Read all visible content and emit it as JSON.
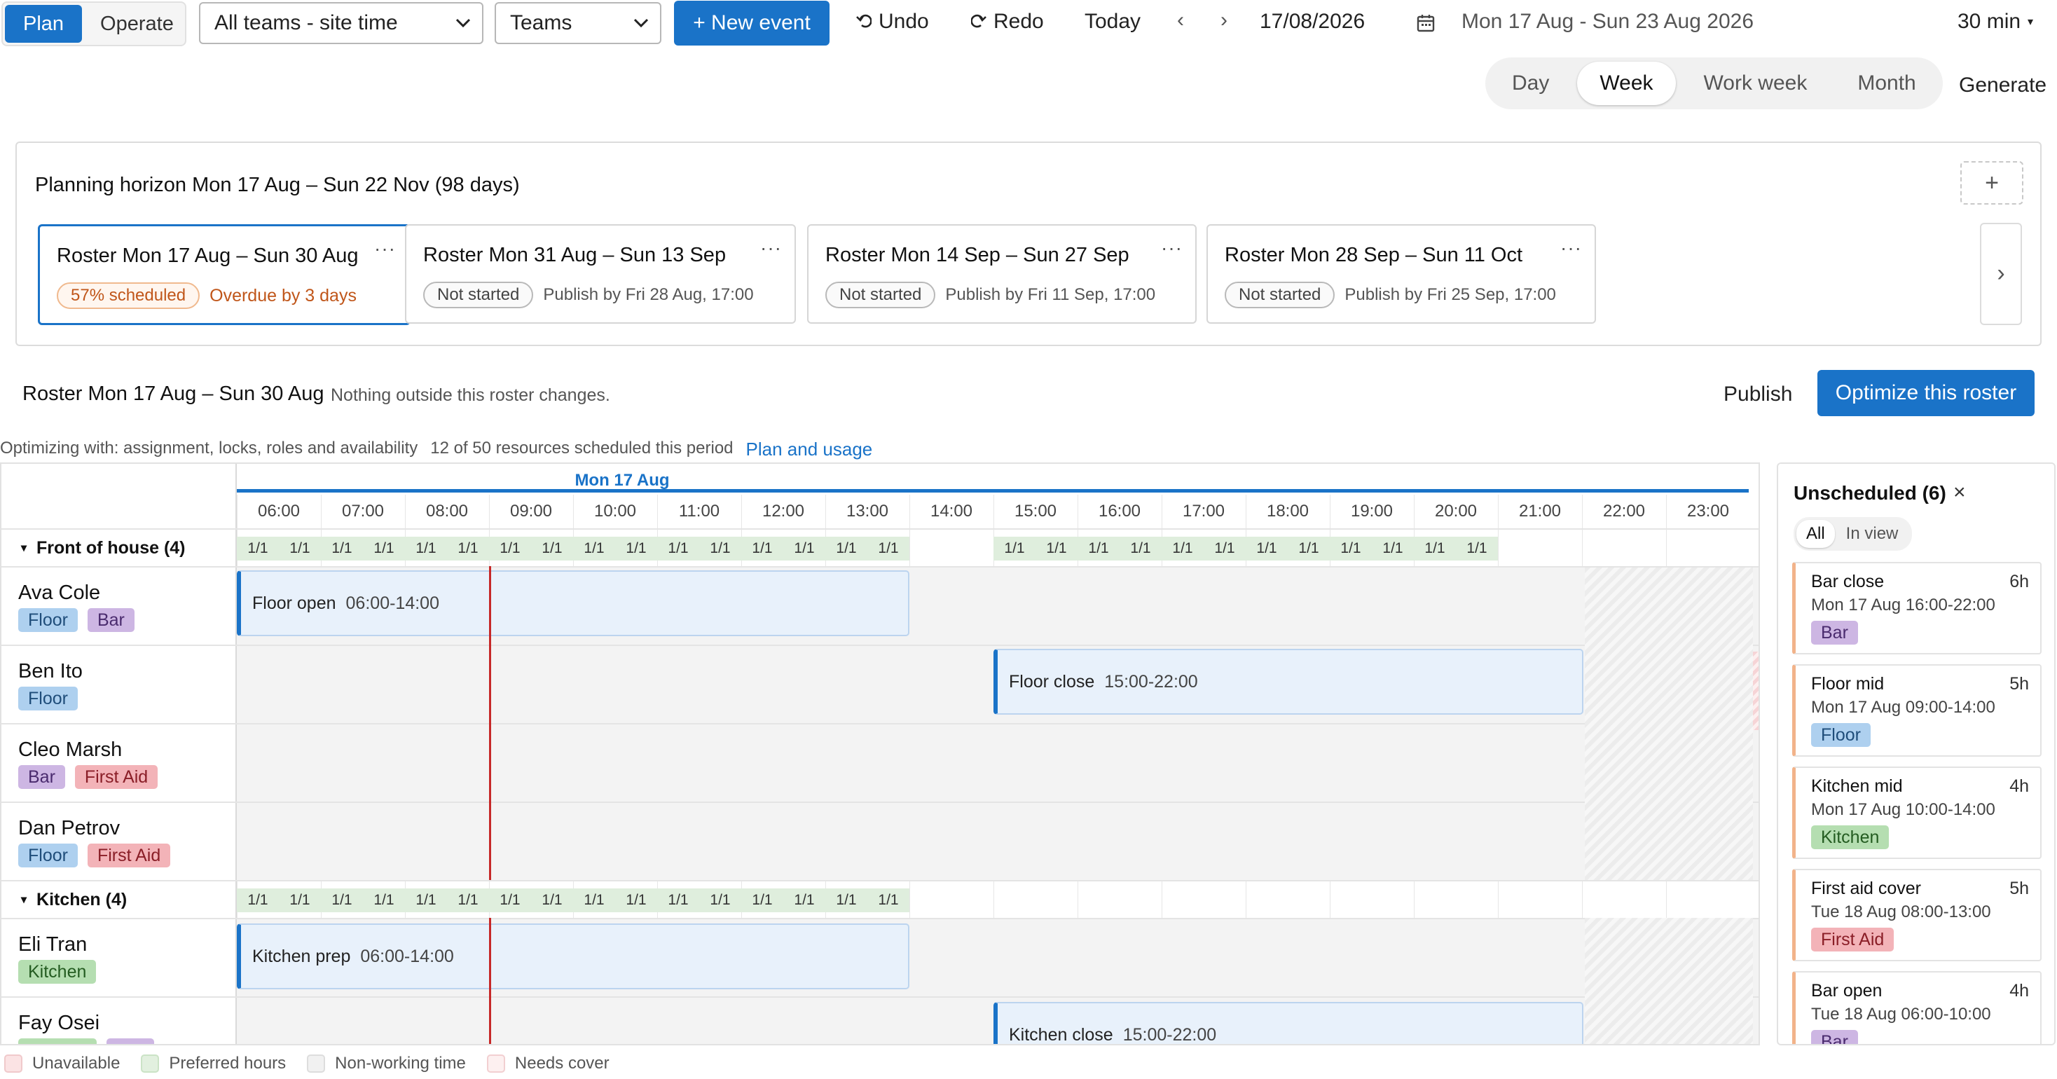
{
  "toolbar": {
    "mode_options": [
      "Plan",
      "Operate"
    ],
    "teams_filter_value": "All teams - site time",
    "group_by_value": "Teams",
    "new_event_label": "+ New event",
    "undo_label": "Undo",
    "redo_label": "Redo",
    "today_label": "Today",
    "prev_glyph": "‹",
    "next_glyph": "›",
    "date_value": "17/08/2026",
    "range_label": "Mon 17 Aug - Sun 23 Aug 2026",
    "interval_label": "30 min",
    "interval_caret": "▾",
    "views": [
      "Day",
      "Week",
      "Work week",
      "Month"
    ],
    "active_view": "Week",
    "generate_label": "Generate"
  },
  "horizon": {
    "title": "Planning horizon Mon 17 Aug – Sun 22 Nov (98 days)",
    "add_glyph": "+",
    "next_glyph": "›",
    "rosters": [
      {
        "title": "Roster Mon 17 Aug – Sun 30 Aug",
        "status": "57% scheduled",
        "note": "Overdue by 3 days",
        "active": true
      },
      {
        "title": "Roster Mon 31 Aug – Sun 13 Sep",
        "status": "Not started",
        "note": "Publish by Fri 28 Aug, 17:00",
        "active": false
      },
      {
        "title": "Roster Mon 14 Sep – Sun 27 Sep",
        "status": "Not started",
        "note": "Publish by Fri 11 Sep, 17:00",
        "active": false
      },
      {
        "title": "Roster Mon 28 Sep – Sun 11 Oct",
        "status": "Not started",
        "note": "Publish by Fri 25 Sep, 17:00",
        "active": false
      }
    ]
  },
  "roster_bar": {
    "title": "Roster Mon 17 Aug – Sun 30 Aug",
    "subtitle": "Nothing outside this roster changes.",
    "publish_label": "Publish",
    "optimize_label": "Optimize this roster"
  },
  "optimizing": {
    "text": "Optimizing with: assignment, locks, roles and availability",
    "count_text": "12 of 50 resources scheduled this period",
    "link_label": "Plan and usage"
  },
  "schedule": {
    "day_label": "Mon 17 Aug",
    "hours": [
      "06:00",
      "07:00",
      "08:00",
      "09:00",
      "10:00",
      "11:00",
      "12:00",
      "13:00",
      "14:00",
      "15:00",
      "16:00",
      "17:00",
      "18:00",
      "19:00",
      "20:00",
      "21:00",
      "22:00",
      "23:00"
    ],
    "coverage_label": "1/1",
    "groups": [
      {
        "name": "Front of house (4)",
        "caret": "▾"
      },
      {
        "name": "Kitchen (4)",
        "caret": "▾"
      }
    ],
    "people": [
      {
        "name": "Ava Cole",
        "tags": [
          "Floor",
          "Bar"
        ],
        "event": {
          "title": "Floor open",
          "time": "06:00-14:00"
        }
      },
      {
        "name": "Ben Ito",
        "tags": [
          "Floor"
        ],
        "event": {
          "title": "Floor close",
          "time": "15:00-22:00"
        }
      },
      {
        "name": "Cleo Marsh",
        "tags": [
          "Bar",
          "First Aid"
        ]
      },
      {
        "name": "Dan Petrov",
        "tags": [
          "Floor",
          "First Aid"
        ]
      },
      {
        "name": "Eli Tran",
        "tags": [
          "Kitchen"
        ],
        "event": {
          "title": "Kitchen prep",
          "time": "06:00-14:00"
        }
      },
      {
        "name": "Fay Osei",
        "tags": [],
        "event": {
          "title": "Kitchen close",
          "time": "15:00-22:00"
        }
      }
    ]
  },
  "unscheduled": {
    "title": "Unscheduled (6)",
    "close_glyph": "×",
    "filters": [
      "All",
      "In view"
    ],
    "items": [
      {
        "title": "Bar close",
        "hours": "6h",
        "date": "Mon 17 Aug 16:00-22:00",
        "tag": "Bar"
      },
      {
        "title": "Floor mid",
        "hours": "5h",
        "date": "Mon 17 Aug 09:00-14:00",
        "tag": "Floor"
      },
      {
        "title": "Kitchen mid",
        "hours": "4h",
        "date": "Mon 17 Aug 10:00-14:00",
        "tag": "Kitchen"
      },
      {
        "title": "First aid cover",
        "hours": "5h",
        "date": "Tue 18 Aug 08:00-13:00",
        "tag": "First Aid"
      },
      {
        "title": "Bar open",
        "hours": "4h",
        "date": "Tue 18 Aug 06:00-10:00",
        "tag": "Bar"
      }
    ]
  },
  "legend": [
    "Unavailable",
    "Preferred hours",
    "Non-working time",
    "Needs cover"
  ],
  "colors": {
    "accent": "#1a73c8",
    "now_line": "#c62828",
    "floor": "#aed0ef",
    "bar": "#cdb6e3",
    "kitchen": "#b5deb1",
    "first_aid": "#f3b3b8",
    "overdue": "#c0561a"
  }
}
